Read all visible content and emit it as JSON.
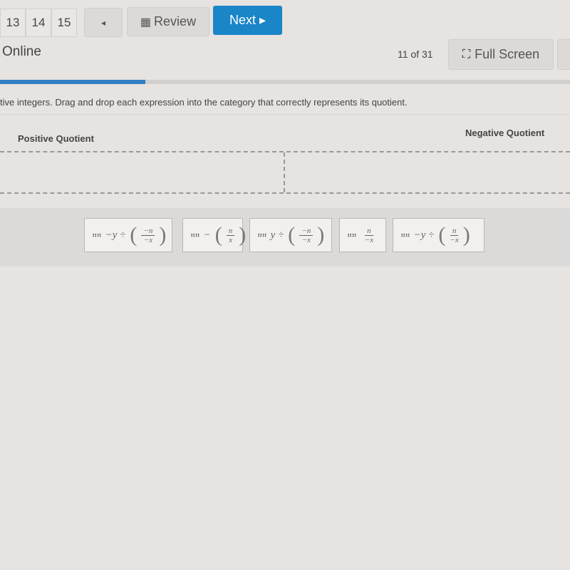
{
  "nav": {
    "question_numbers": [
      "13",
      "14",
      "15"
    ],
    "prev_label": "◂",
    "review_label": "Review",
    "next_label": "Next ▸"
  },
  "header": {
    "title": "Online",
    "counter": "11 of 31",
    "fullscreen_label": "Full Screen"
  },
  "progress": {
    "current": 11,
    "total": 31,
    "color": "#2f7fc1"
  },
  "instructions": "tive integers. Drag and drop each expression into the category that correctly represents its quotient.",
  "categories": [
    {
      "label": "Positive Quotient"
    },
    {
      "label": "Negative Quotient"
    }
  ],
  "tiles": [
    {
      "prefix": "−y ÷",
      "num": "−n",
      "den": "−x",
      "paren": true
    },
    {
      "prefix": "−",
      "num": "n",
      "den": "x",
      "paren": true
    },
    {
      "prefix": "y ÷",
      "num": "−n",
      "den": "−x",
      "paren": true
    },
    {
      "prefix": "",
      "num": "n",
      "den": "−x",
      "paren": false
    },
    {
      "prefix": "−y ÷",
      "num": "n",
      "den": "−x",
      "paren": true
    }
  ],
  "colors": {
    "accent": "#1a86c8"
  }
}
